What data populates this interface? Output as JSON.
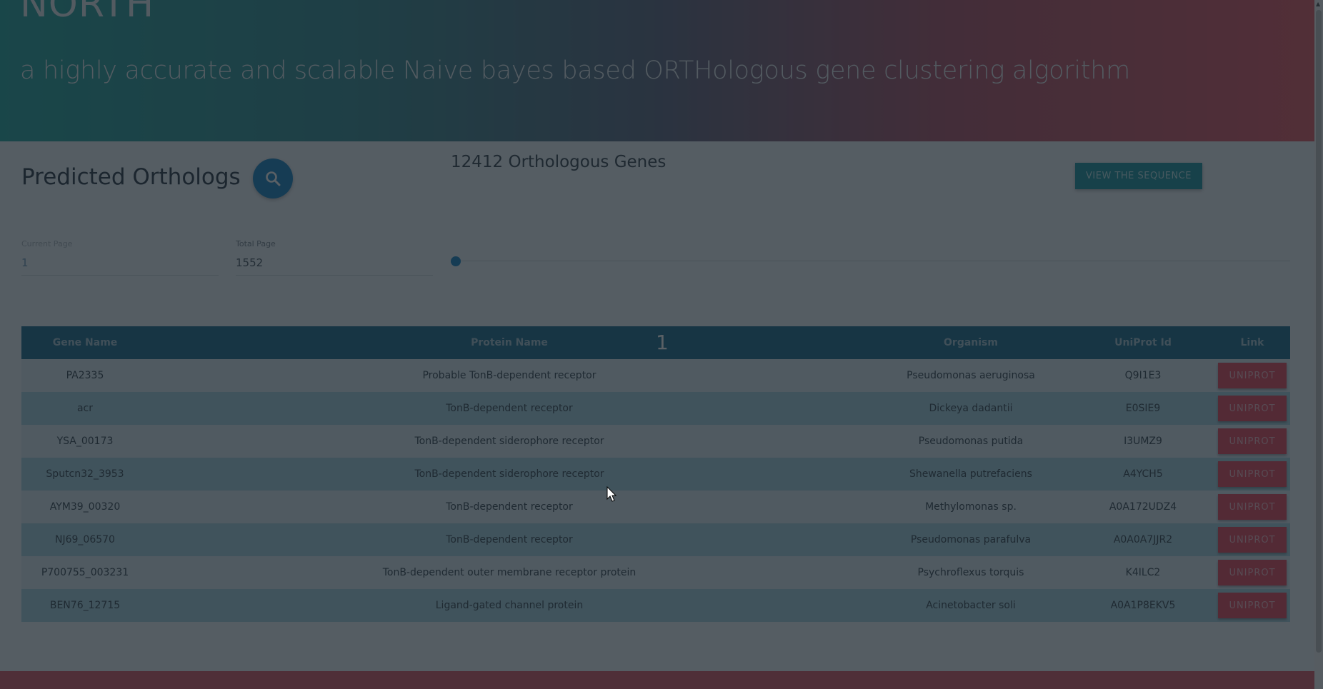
{
  "header": {
    "title": "NORTH",
    "subtitle": "a highly accurate and scalable Naive bayes based ORTHologous gene clustering algorithm"
  },
  "section": {
    "title": "Predicted Orthologs",
    "search_icon": "search-icon",
    "genes_count": "12412 Orthologous Genes",
    "view_sequence_label": "VIEW THE SEQUENCE"
  },
  "pagination": {
    "current_page_label": "Current Page",
    "current_page_value": "1",
    "total_page_label": "Total Page",
    "total_page_value": "1552",
    "slider_value": 1,
    "page_indicator": "1"
  },
  "table": {
    "headers": [
      "Gene Name",
      "Protein Name",
      "Organism",
      "UniProt Id",
      "Link"
    ],
    "button_label": "UNIPROT",
    "rows": [
      {
        "gene": "PA2335",
        "protein": "Probable TonB-dependent receptor",
        "organism": "Pseudomonas aeruginosa",
        "uniprot": "Q9I1E3"
      },
      {
        "gene": "acr",
        "protein": "TonB-dependent receptor",
        "organism": "Dickeya dadantii",
        "uniprot": "E0SIE9"
      },
      {
        "gene": "YSA_00173",
        "protein": "TonB-dependent siderophore receptor",
        "organism": "Pseudomonas putida",
        "uniprot": "I3UMZ9"
      },
      {
        "gene": "Sputcn32_3953",
        "protein": "TonB-dependent siderophore receptor",
        "organism": "Shewanella putrefaciens",
        "uniprot": "A4YCH5"
      },
      {
        "gene": "AYM39_00320",
        "protein": "TonB-dependent receptor",
        "organism": "Methylomonas sp.",
        "uniprot": "A0A172UDZ4"
      },
      {
        "gene": "NJ69_06570",
        "protein": "TonB-dependent receptor",
        "organism": "Pseudomonas parafulva",
        "uniprot": "A0A0A7JJR2"
      },
      {
        "gene": "P700755_003231",
        "protein": "TonB-dependent outer membrane receptor protein",
        "organism": "Psychroflexus torquis",
        "uniprot": "K4ILC2"
      },
      {
        "gene": "BEN76_12715",
        "protein": "Ligand-gated channel protein",
        "organism": "Acinetobacter soli",
        "uniprot": "A0A1P8EKV5"
      }
    ]
  },
  "colors": {
    "accent_blue": "#1d88c7",
    "teal": "#1e96a4",
    "uniprot_red": "#e84a60",
    "header_bar": "#1f6f8f"
  }
}
